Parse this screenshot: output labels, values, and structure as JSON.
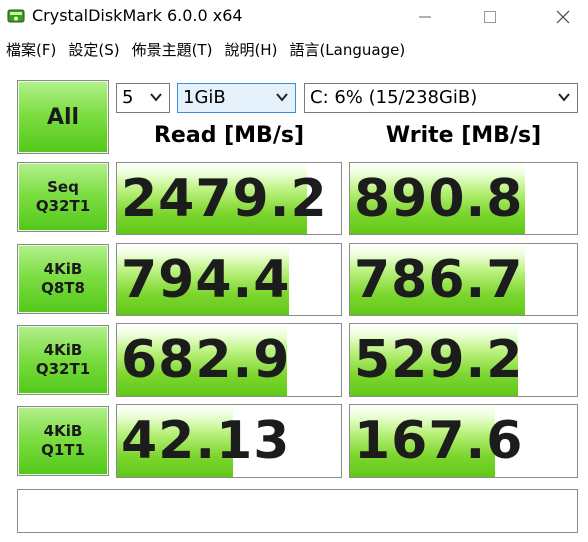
{
  "window": {
    "title": "CrystalDiskMark 6.0.0 x64"
  },
  "menu": [
    {
      "label": "檔案(F)"
    },
    {
      "label": "設定(S)"
    },
    {
      "label": "佈景主題(T)"
    },
    {
      "label": "說明(H)"
    },
    {
      "label": "語言(Language)"
    }
  ],
  "controls": {
    "all_label": "All",
    "count": "5",
    "size": "1GiB",
    "drive": "C: 6% (15/238GiB)"
  },
  "headers": {
    "read": "Read [MB/s]",
    "write": "Write [MB/s]"
  },
  "tests": [
    {
      "line1": "Seq",
      "line2": "Q32T1",
      "read": "2479.2",
      "write": "890.8",
      "read_fill": 0.85,
      "write_fill": 0.77
    },
    {
      "line1": "4KiB",
      "line2": "Q8T8",
      "read": "794.4",
      "write": "786.7",
      "read_fill": 0.77,
      "write_fill": 0.77
    },
    {
      "line1": "4KiB",
      "line2": "Q32T1",
      "read": "682.9",
      "write": "529.2",
      "read_fill": 0.76,
      "write_fill": 0.74
    },
    {
      "line1": "4KiB",
      "line2": "Q1T1",
      "read": "42.13",
      "write": "167.6",
      "read_fill": 0.52,
      "write_fill": 0.64
    }
  ],
  "comment": "",
  "colors": {
    "accent_green": "#52c818",
    "bar_green": "#7ed630",
    "border": "#8c8c8c"
  }
}
